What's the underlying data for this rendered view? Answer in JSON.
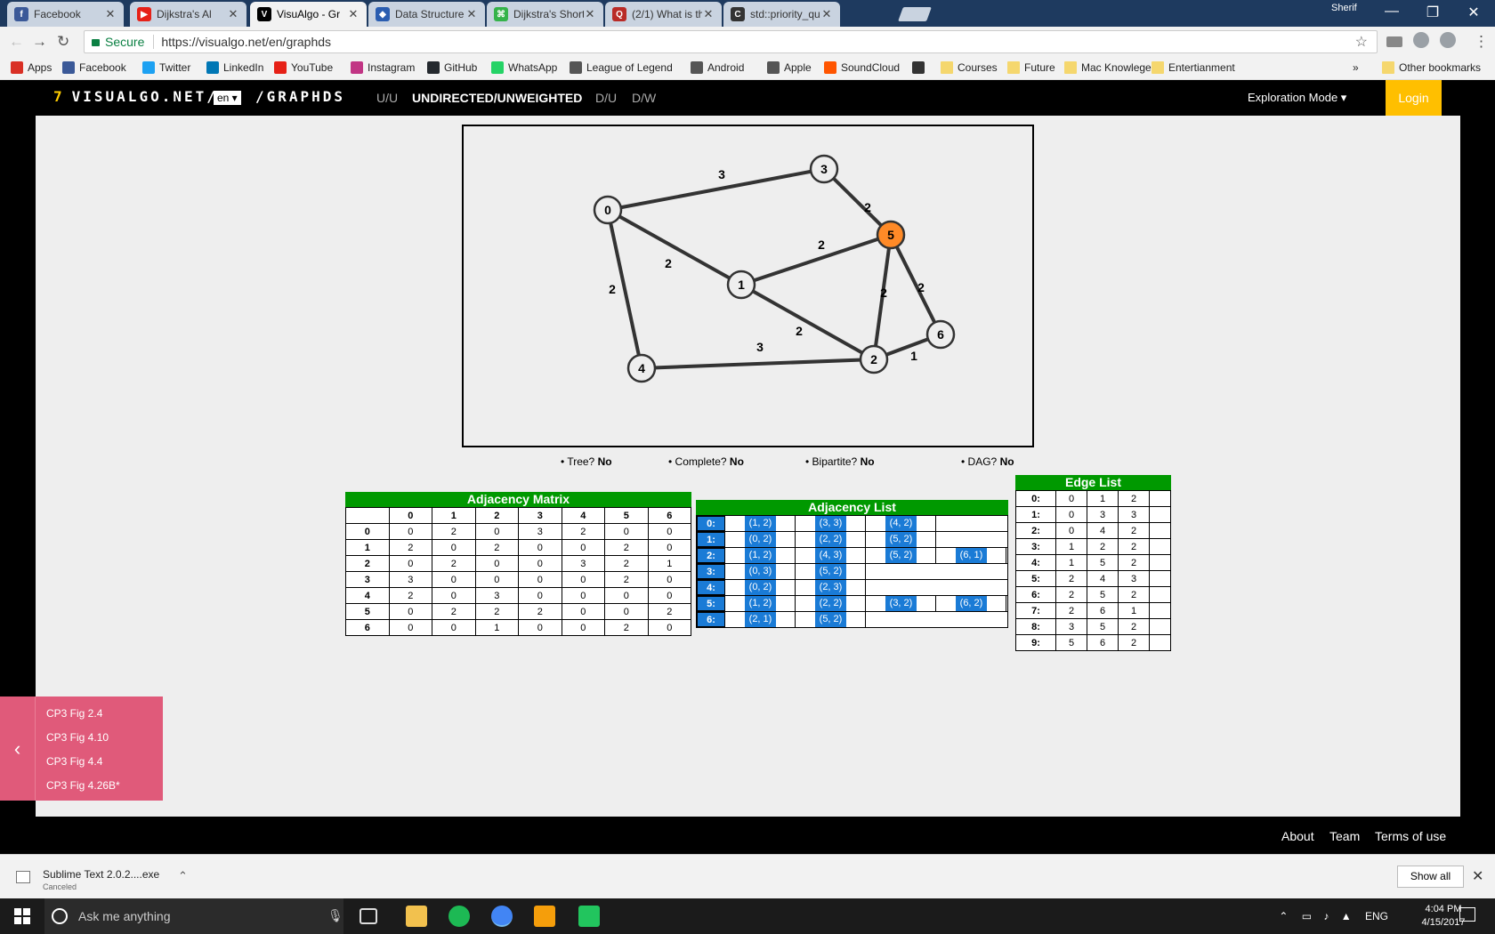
{
  "browser": {
    "tabs": [
      {
        "title": "Facebook",
        "icon": "facebook-icon",
        "color": "#3b5998",
        "glyph": "f"
      },
      {
        "title": "Dijkstra's Al",
        "icon": "youtube-icon",
        "color": "#e62117",
        "glyph": "▶"
      },
      {
        "title": "VisuAlgo - Gr",
        "icon": "visualgo-icon",
        "color": "#000000",
        "glyph": "V"
      },
      {
        "title": "Data Structure",
        "icon": "shield-icon",
        "color": "#2a5db0",
        "glyph": "◆"
      },
      {
        "title": "Dijkstra's Short",
        "icon": "hackerearth-icon",
        "color": "#35b34a",
        "glyph": "⌘"
      },
      {
        "title": "(2/1) What is th",
        "icon": "quora-icon",
        "color": "#b92b27",
        "glyph": "Q"
      },
      {
        "title": "std::priority_qu",
        "icon": "cppreference-icon",
        "color": "#333333",
        "glyph": "C"
      }
    ],
    "profile": "Sherif",
    "secure_label": "Secure",
    "url": "https://visualgo.net/en/graphds",
    "bookmarks": [
      {
        "label": "Apps",
        "icon": "apps-icon",
        "color": "#d93025"
      },
      {
        "label": "Facebook",
        "icon": "facebook-icon",
        "color": "#3b5998"
      },
      {
        "label": "Twitter",
        "icon": "twitter-icon",
        "color": "#1da1f2"
      },
      {
        "label": "LinkedIn",
        "icon": "linkedin-icon",
        "color": "#0077b5"
      },
      {
        "label": "YouTube",
        "icon": "youtube-icon",
        "color": "#e62117"
      },
      {
        "label": "Instagram",
        "icon": "instagram-icon",
        "color": "#c13584"
      },
      {
        "label": "GitHub",
        "icon": "github-icon",
        "color": "#24292e"
      },
      {
        "label": "WhatsApp",
        "icon": "whatsapp-icon",
        "color": "#25d366"
      },
      {
        "label": "League of Legend",
        "icon": "league-icon",
        "color": "#555555"
      },
      {
        "label": "Android",
        "icon": "android-icon",
        "color": "#555555"
      },
      {
        "label": "Apple",
        "icon": "apple-icon",
        "color": "#555555"
      },
      {
        "label": "SoundCloud",
        "icon": "soundcloud-icon",
        "color": "#ff5500"
      },
      {
        "label": "",
        "icon": "bookmark-icon",
        "color": "#333333"
      },
      {
        "label": "Courses",
        "icon": "folder-icon",
        "color": "#f5d76e"
      },
      {
        "label": "Future",
        "icon": "folder-icon",
        "color": "#f5d76e"
      },
      {
        "label": "Mac Knowlege",
        "icon": "folder-icon",
        "color": "#f5d76e"
      },
      {
        "label": "Entertianment",
        "icon": "folder-icon",
        "color": "#f5d76e"
      }
    ],
    "overflow": "»",
    "other_bookmarks": "Other bookmarks"
  },
  "visualgo": {
    "logo": "VISUALGO.NET/",
    "logo_mark": "7",
    "lang": "en ▾",
    "module": "/GRAPHDS",
    "graph_tabs": [
      "U/U",
      "UNDIRECTED/UNWEIGHTED",
      "D/U",
      "D/W"
    ],
    "mode": "Exploration Mode ▾",
    "login": "Login"
  },
  "graph": {
    "nodes": [
      {
        "id": "0",
        "x": 0.0,
        "y": 0.0
      },
      {
        "id": "1",
        "x": 0.0,
        "y": 0.0
      },
      {
        "id": "2",
        "x": 0.0,
        "y": 0.0
      },
      {
        "id": "3",
        "x": 0.0,
        "y": 0.0
      },
      {
        "id": "4",
        "x": 0.0,
        "y": 0.0
      },
      {
        "id": "5",
        "x": 0.0,
        "y": 0.0,
        "highlighted": true
      },
      {
        "id": "6",
        "x": 0.0,
        "y": 0.0
      }
    ],
    "edges": [
      {
        "u": 0,
        "v": 1,
        "w": "2"
      },
      {
        "u": 0,
        "v": 3,
        "w": "3"
      },
      {
        "u": 0,
        "v": 4,
        "w": "2"
      },
      {
        "u": 1,
        "v": 2,
        "w": "2"
      },
      {
        "u": 1,
        "v": 5,
        "w": "2"
      },
      {
        "u": 2,
        "v": 4,
        "w": "3"
      },
      {
        "u": 2,
        "v": 5,
        "w": "2"
      },
      {
        "u": 2,
        "v": 6,
        "w": "1"
      },
      {
        "u": 3,
        "v": 5,
        "w": "2"
      },
      {
        "u": 5,
        "v": 6,
        "w": "2"
      }
    ],
    "highlight_color": "#ff8a27"
  },
  "properties": {
    "tree": {
      "label": "• Tree?",
      "value": "No"
    },
    "complete": {
      "label": "• Complete?",
      "value": "No"
    },
    "bipartite": {
      "label": "• Bipartite?",
      "value": "No"
    },
    "dag": {
      "label": "• DAG?",
      "value": "No"
    }
  },
  "adjacency_matrix": {
    "title": "Adjacency Matrix",
    "headers": [
      "0",
      "1",
      "2",
      "3",
      "4",
      "5",
      "6"
    ],
    "rows": [
      [
        "0",
        "2",
        "0",
        "3",
        "2",
        "0",
        "0"
      ],
      [
        "2",
        "0",
        "2",
        "0",
        "0",
        "2",
        "0"
      ],
      [
        "0",
        "2",
        "0",
        "0",
        "3",
        "2",
        "1"
      ],
      [
        "3",
        "0",
        "0",
        "0",
        "0",
        "2",
        "0"
      ],
      [
        "2",
        "0",
        "3",
        "0",
        "0",
        "0",
        "0"
      ],
      [
        "0",
        "2",
        "2",
        "2",
        "0",
        "0",
        "2"
      ],
      [
        "0",
        "0",
        "1",
        "0",
        "0",
        "2",
        "0"
      ]
    ]
  },
  "adjacency_list": {
    "title": "Adjacency List",
    "rows": [
      {
        "idx": "0:",
        "pairs": [
          "(1, 2)",
          "(3, 3)",
          "(4, 2)"
        ]
      },
      {
        "idx": "1:",
        "pairs": [
          "(0, 2)",
          "(2, 2)",
          "(5, 2)"
        ]
      },
      {
        "idx": "2:",
        "pairs": [
          "(1, 2)",
          "(4, 3)",
          "(5, 2)",
          "(6, 1)"
        ]
      },
      {
        "idx": "3:",
        "pairs": [
          "(0, 3)",
          "(5, 2)"
        ]
      },
      {
        "idx": "4:",
        "pairs": [
          "(0, 2)",
          "(2, 3)"
        ]
      },
      {
        "idx": "5:",
        "pairs": [
          "(1, 2)",
          "(2, 2)",
          "(3, 2)",
          "(6, 2)"
        ]
      },
      {
        "idx": "6:",
        "pairs": [
          "(2, 1)",
          "(5, 2)"
        ]
      }
    ]
  },
  "edge_list": {
    "title": "Edge List",
    "rows": [
      [
        "0:",
        "0",
        "1",
        "2"
      ],
      [
        "1:",
        "0",
        "3",
        "3"
      ],
      [
        "2:",
        "0",
        "4",
        "2"
      ],
      [
        "3:",
        "1",
        "2",
        "2"
      ],
      [
        "4:",
        "1",
        "5",
        "2"
      ],
      [
        "5:",
        "2",
        "4",
        "3"
      ],
      [
        "6:",
        "2",
        "5",
        "2"
      ],
      [
        "7:",
        "2",
        "6",
        "1"
      ],
      [
        "8:",
        "3",
        "5",
        "2"
      ],
      [
        "9:",
        "5",
        "6",
        "2"
      ]
    ]
  },
  "samples": [
    "CP3 Fig 2.4",
    "CP3 Fig 4.10",
    "CP3 Fig 4.4",
    "CP3 Fig 4.26B*"
  ],
  "samples_toggle": "‹",
  "footer": [
    "About",
    "Team",
    "Terms of use"
  ],
  "downloads": {
    "name": "Sublime Text 2.0.2....exe",
    "status": "Canceled",
    "show_all": "Show all"
  },
  "taskbar": {
    "search_placeholder": "Ask me anything",
    "tray_lang": "ENG",
    "time": "4:04 PM",
    "date": "4/15/2017"
  }
}
